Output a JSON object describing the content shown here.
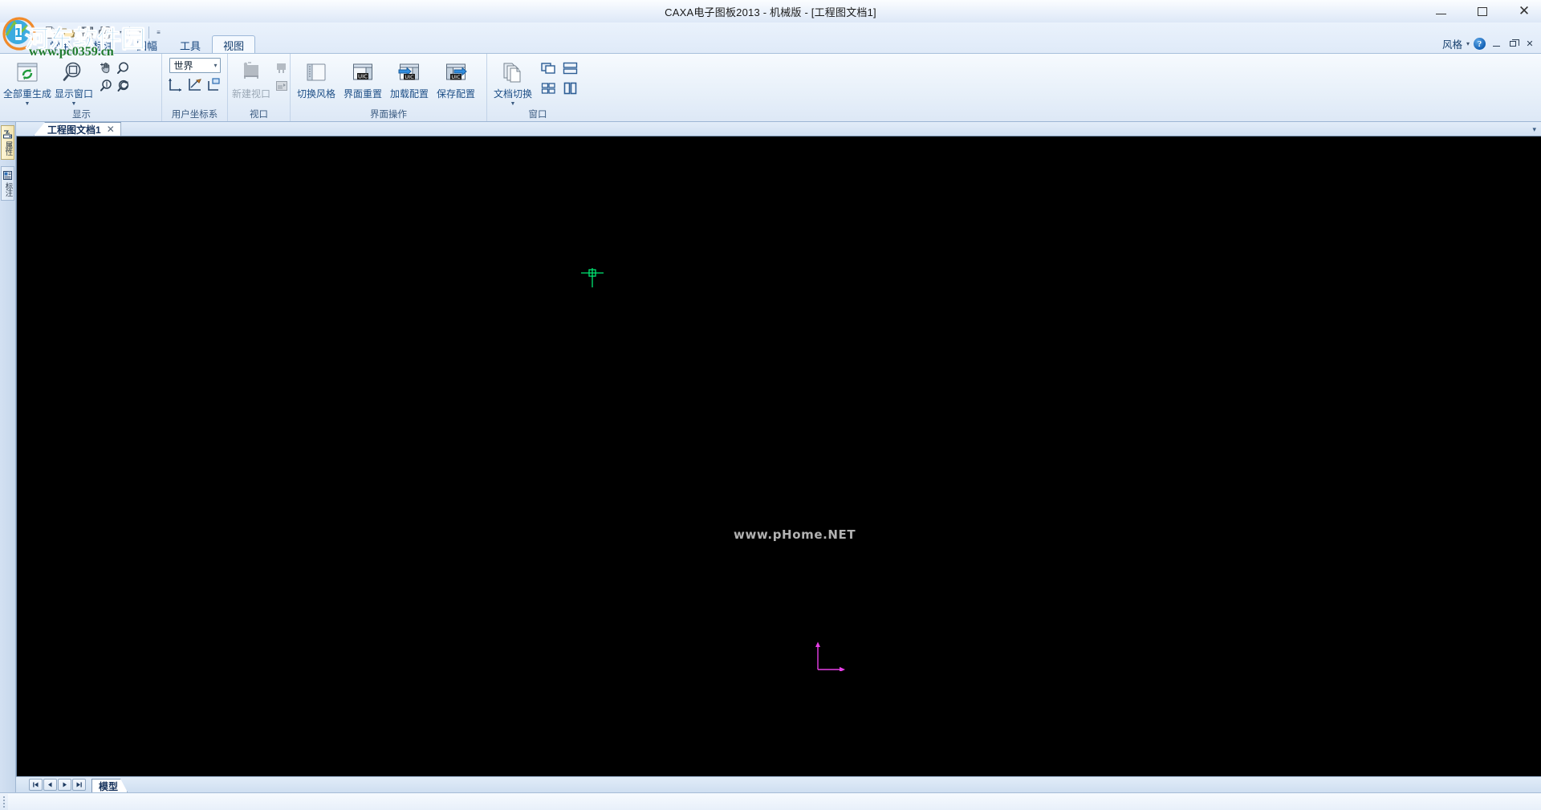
{
  "window": {
    "title": "CAXA电子图板2013 - 机械版 - [工程图文档1]",
    "minimize": "—",
    "maximize": "☐",
    "close": "✕"
  },
  "quick_access": {
    "items": [
      {
        "name": "new-file",
        "icon": "new-document-icon"
      },
      {
        "name": "open-file",
        "icon": "open-folder-icon"
      },
      {
        "name": "save-file",
        "icon": "save-disk-icon"
      },
      {
        "name": "print-file",
        "icon": "printer-icon"
      }
    ],
    "dropdown_caret": "▾",
    "customize_caret": "▾",
    "overflow_caret": "≡"
  },
  "tabs": [
    {
      "label": "常用",
      "active": false
    },
    {
      "label": "标注",
      "active": false
    },
    {
      "label": "图幅",
      "active": false
    },
    {
      "label": "工具",
      "active": false
    },
    {
      "label": "视图",
      "active": true
    }
  ],
  "style_area": {
    "label": "风格",
    "caret": "▾",
    "help": "?",
    "doc_minimize": "minimize",
    "doc_restore": "restore",
    "doc_close": "✕"
  },
  "ribbon": {
    "panels": [
      {
        "name": "display",
        "label": "显示",
        "buttons": [
          {
            "label": "全部重生成",
            "icon": "regenerate-all-icon",
            "dropdown": true,
            "disabled": false
          },
          {
            "label": "显示窗口",
            "icon": "zoom-window-icon",
            "dropdown": true,
            "disabled": false
          }
        ],
        "mini_icons": [
          {
            "name": "pan-icon"
          },
          {
            "name": "zoom-in-icon"
          },
          {
            "name": "zoom-out-icon"
          },
          {
            "name": "zoom-previous-icon"
          }
        ]
      },
      {
        "name": "ucs",
        "label": "用户坐标系",
        "combo": {
          "value": "世界",
          "caret": "▾"
        },
        "mini_icons": [
          {
            "name": "new-ucs-icon"
          },
          {
            "name": "edit-ucs-icon"
          },
          {
            "name": "ucs-manager-icon"
          }
        ]
      },
      {
        "name": "viewport",
        "label": "视口",
        "buttons": [
          {
            "label": "新建视口",
            "icon": "new-viewport-icon",
            "dropdown": false,
            "disabled": true
          }
        ],
        "mini_icons": [
          {
            "name": "viewport-join-icon"
          },
          {
            "name": "viewport-settings-icon"
          }
        ]
      },
      {
        "name": "ui-operations",
        "label": "界面操作",
        "buttons": [
          {
            "label": "切换风格",
            "icon": "switch-style-icon",
            "dropdown": false,
            "disabled": false
          },
          {
            "label": "界面重置",
            "icon": "uic-reset-icon",
            "dropdown": false,
            "disabled": false
          },
          {
            "label": "加载配置",
            "icon": "uic-load-icon",
            "dropdown": false,
            "disabled": false
          },
          {
            "label": "保存配置",
            "icon": "uic-save-icon",
            "dropdown": false,
            "disabled": false
          }
        ]
      },
      {
        "name": "windows",
        "label": "窗口",
        "buttons": [
          {
            "label": "文档切换",
            "icon": "document-switch-icon",
            "dropdown": true,
            "disabled": false
          }
        ],
        "mini_icons": [
          {
            "name": "cascade-windows-icon"
          },
          {
            "name": "tile-horizontal-icon"
          },
          {
            "name": "tile-grid-icon"
          },
          {
            "name": "tile-vertical-icon"
          }
        ]
      }
    ]
  },
  "left_sidebar": {
    "tabs": [
      {
        "name": "property-panel",
        "label": "属性",
        "icon": "property-icon"
      },
      {
        "name": "annotation-panel",
        "label": "标注",
        "icon": "annotation-icon"
      }
    ]
  },
  "document_tabs": {
    "tabs": [
      {
        "label": "工程图文档1",
        "close": "✕",
        "active": true
      }
    ],
    "overflow_caret": "▾"
  },
  "canvas": {
    "watermark": "www.pHome.NET",
    "crosshair_color": "#00ff66",
    "axis_color": "#e040e0",
    "background": "#000000"
  },
  "bottom_bar": {
    "nav_buttons": [
      {
        "name": "first-sheet",
        "glyph": "⏮"
      },
      {
        "name": "prev-sheet",
        "glyph": "◀"
      },
      {
        "name": "next-sheet",
        "glyph": "▶"
      },
      {
        "name": "last-sheet",
        "glyph": "⏭"
      }
    ],
    "sheet_tabs": [
      {
        "label": "模型",
        "active": true
      }
    ]
  },
  "brand_watermark": {
    "text": "河东软件园",
    "url": "www.pc0359.cn"
  }
}
